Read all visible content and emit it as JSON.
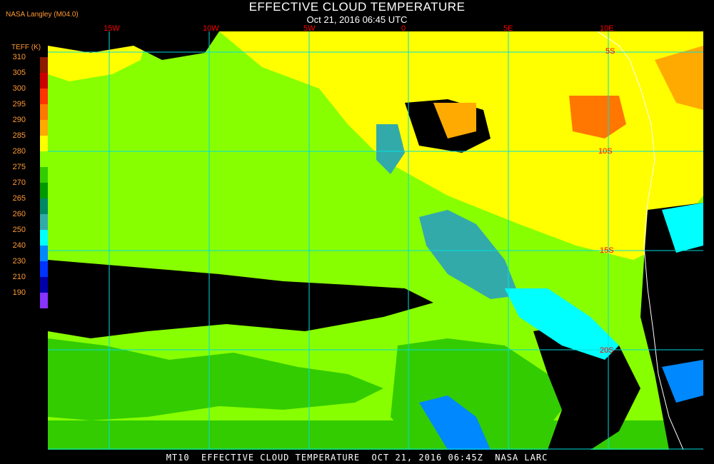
{
  "header": {
    "title": "EFFECTIVE CLOUD TEMPERATURE",
    "subtitle": "Oct 21, 2016 06:45 UTC",
    "credit": "NASA Langley  (M04.0)"
  },
  "legend": {
    "title": "TEFF (K)",
    "ticks": [
      "310",
      "305",
      "300",
      "295",
      "290",
      "285",
      "280",
      "275",
      "270",
      "265",
      "260",
      "250",
      "240",
      "230",
      "210",
      "190"
    ],
    "colors": [
      "#8b1a00",
      "#cc0000",
      "#ff3300",
      "#ff7700",
      "#ffaa00",
      "#ffff00",
      "#88ff00",
      "#33cc00",
      "#009900",
      "#008866",
      "#33aaaa",
      "#00ffff",
      "#0088ff",
      "#0033ff",
      "#0000aa",
      "#8833ff"
    ]
  },
  "map": {
    "lon_labels": [
      "15W",
      "10W",
      "5W",
      "0",
      "5E",
      "10E"
    ],
    "lat_labels": [
      "5S",
      "10S",
      "15S",
      "20S"
    ]
  },
  "footer": {
    "text": "MT10  EFFECTIVE CLOUD TEMPERATURE  OCT 21, 2016 06:45Z  NASA LARC"
  }
}
